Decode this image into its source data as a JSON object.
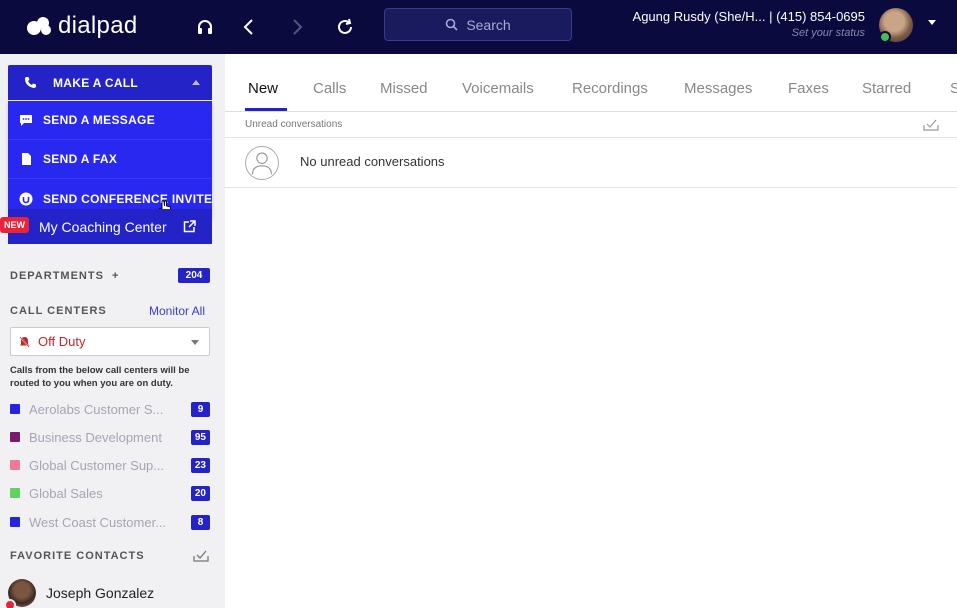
{
  "app": {
    "logo": "dialpad"
  },
  "topbar": {
    "search_placeholder": "Search",
    "user_name": "Agung Rusdy (She/H...  | (415) 854-0695",
    "user_status": "Set your status",
    "icons": [
      "headset-icon",
      "back-icon",
      "forward-icon",
      "refresh-icon",
      "search-icon",
      "chevron-down-icon"
    ]
  },
  "sidebar": {
    "make_call": "MAKE A CALL",
    "menu": [
      {
        "label": "SEND A MESSAGE",
        "icon": "message-icon"
      },
      {
        "label": "SEND A FAX",
        "icon": "fax-icon"
      },
      {
        "label": "SEND CONFERENCE INVITE",
        "icon": "conference-icon"
      }
    ],
    "coaching": {
      "badge": "NEW",
      "label": "My Coaching Center"
    },
    "departments": {
      "label": "DEPARTMENTS",
      "plus": "+",
      "count": "204"
    },
    "call_centers": {
      "label": "CALL CENTERS",
      "monitor_all": "Monitor All",
      "duty": "Off Duty",
      "note": "Calls from the below call centers will be routed to you when you are on duty.",
      "items": [
        {
          "name": "Aerolabs Customer S...",
          "count": "9",
          "color": "#2323e0"
        },
        {
          "name": "Business Development",
          "count": "95",
          "color": "#7a1a6e"
        },
        {
          "name": "Global Customer Sup...",
          "count": "23",
          "color": "#f07a9a"
        },
        {
          "name": "Global Sales",
          "count": "20",
          "color": "#5fd25f"
        },
        {
          "name": "West Coast Customer...",
          "count": "8",
          "color": "#2323e0"
        }
      ]
    },
    "favorites": {
      "label": "FAVORITE CONTACTS",
      "contacts": [
        {
          "name": "Joseph Gonzalez"
        }
      ]
    }
  },
  "main": {
    "tabs": [
      "New",
      "Calls",
      "Missed",
      "Voicemails",
      "Recordings",
      "Messages",
      "Faxes",
      "Starred",
      "S"
    ],
    "active_tab": "New",
    "unread_label": "Unread conversations",
    "empty_text": "No unread conversations"
  },
  "colors": {
    "brand": "#2323c8",
    "topbar": "#0a0a3e",
    "off_duty": "#c1272d"
  }
}
